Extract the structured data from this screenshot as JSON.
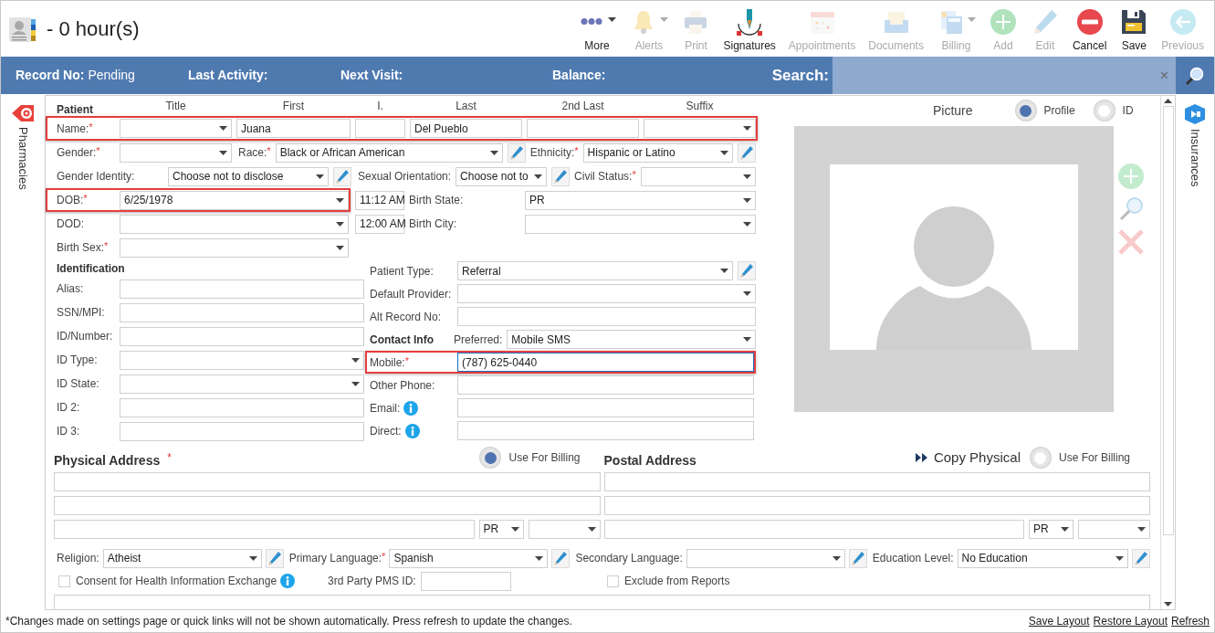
{
  "header": {
    "title": "- 0 hour(s)"
  },
  "toolbar": [
    {
      "label": "More",
      "kind": "more",
      "disabled": false,
      "dropdown": true
    },
    {
      "label": "Alerts",
      "kind": "bell",
      "disabled": true,
      "dropdown": true
    },
    {
      "label": "Print",
      "kind": "printer",
      "disabled": true,
      "dropdown": false
    },
    {
      "label": "Signatures",
      "kind": "pen",
      "disabled": false,
      "dropdown": false
    },
    {
      "label": "Appointments",
      "kind": "calendar",
      "disabled": true,
      "dropdown": false
    },
    {
      "label": "Documents",
      "kind": "tray",
      "disabled": true,
      "dropdown": false
    },
    {
      "label": "Billing",
      "kind": "calculator",
      "disabled": true,
      "dropdown": true
    },
    {
      "label": "Add",
      "kind": "add",
      "disabled": true,
      "dropdown": false
    },
    {
      "label": "Edit",
      "kind": "pencil",
      "disabled": true,
      "dropdown": false
    },
    {
      "label": "Cancel",
      "kind": "cancel",
      "disabled": false,
      "dropdown": false
    },
    {
      "label": "Save",
      "kind": "save",
      "disabled": false,
      "dropdown": false
    },
    {
      "label": "Previous",
      "kind": "back",
      "disabled": true,
      "dropdown": false
    }
  ],
  "info_bar": {
    "items": [
      {
        "label": "Record No:",
        "value": "Pending"
      },
      {
        "label": "Last Activity:"
      },
      {
        "label": "Next Visit:"
      },
      {
        "label": "Balance:"
      }
    ],
    "search_label": "Search:",
    "search_clear": "×"
  },
  "left_tab": "Pharmacies",
  "right_tab": "Insurances",
  "patient": {
    "heading": "Patient",
    "columns": [
      "Title",
      "First",
      "I.",
      "Last",
      "2nd Last",
      "Suffix"
    ],
    "name": {
      "label": "Name:",
      "required_mark": "*",
      "highlighted": true,
      "fields": [
        {
          "kind": "dropdown"
        },
        {
          "kind": "text",
          "value": "Juana"
        },
        {
          "kind": "text"
        },
        {
          "kind": "text",
          "value": "Del Pueblo"
        },
        {
          "kind": "text"
        },
        {
          "kind": "dropdown"
        }
      ]
    },
    "rows": [
      {
        "highlighted": false,
        "items": [
          {
            "label": "Gender:",
            "required_mark": "*",
            "kind": "dropdown"
          },
          {
            "label": "Race:",
            "required_mark": "*",
            "kind": "dropdown",
            "value": "Black or African American"
          },
          {
            "label": "Ethnicity:",
            "required_mark": "*",
            "kind": "dropdown",
            "value": "Hispanic or Latino"
          }
        ]
      },
      {
        "highlighted": false,
        "items": [
          {
            "label": "Gender Identity:",
            "kind": "dropdown",
            "value": "Choose not to disclose"
          },
          {
            "label": "Sexual Orientation:",
            "kind": "dropdown",
            "value": "Choose not to"
          },
          {
            "label": "Civil Status:",
            "required_mark": "*",
            "kind": "dropdown"
          }
        ]
      },
      {
        "highlighted": true,
        "items": [
          {
            "label": "DOB:",
            "required_mark": "*",
            "kind": "dropdown",
            "value": "6/25/1978"
          },
          {
            "kind": "time",
            "value": "11:12 AM"
          },
          {
            "label": "Birth State:",
            "kind": "dropdown",
            "value": "PR"
          }
        ]
      },
      {
        "highlighted": false,
        "items": [
          {
            "label": "DOD:",
            "kind": "dropdown"
          },
          {
            "kind": "time",
            "value": "12:00 AM"
          },
          {
            "label": "Birth City:",
            "kind": "dropdown"
          }
        ]
      },
      {
        "highlighted": false,
        "items": [
          {
            "label": "Birth Sex:",
            "required_mark": "*",
            "kind": "dropdown"
          }
        ]
      }
    ]
  },
  "identification": {
    "heading": "Identification",
    "rows": [
      {
        "label": "Alias:",
        "kind": "text"
      },
      {
        "label": "SSN/MPI:",
        "kind": "text"
      },
      {
        "label": "ID/Number:",
        "kind": "text"
      },
      {
        "label": "ID Type:",
        "kind": "dropdown"
      },
      {
        "label": "ID State:",
        "kind": "dropdown"
      },
      {
        "label": "ID 2:",
        "kind": "text"
      },
      {
        "label": "ID 3:",
        "kind": "text"
      }
    ]
  },
  "details": [
    {
      "label": "Patient Type:",
      "kind": "dropdown",
      "value": "Referral"
    },
    {
      "label": "Default Provider:",
      "kind": "dropdown"
    },
    {
      "label": "Alt Record No:",
      "kind": "text"
    }
  ],
  "contact": {
    "heading": "Contact Info",
    "preferred": {
      "label": "Preferred:",
      "kind": "dropdown",
      "value": "Mobile SMS"
    },
    "rows": [
      {
        "label": "Mobile:",
        "required_mark": "*",
        "kind": "text",
        "value": "(787) 625-0440",
        "focused": true,
        "highlighted": true,
        "info": false
      },
      {
        "label": "Other Phone:",
        "kind": "text",
        "focused": false,
        "highlighted": false,
        "info": false
      },
      {
        "label": "Email:",
        "kind": "text",
        "focused": false,
        "highlighted": false,
        "info": true
      },
      {
        "label": "Direct:",
        "kind": "text",
        "focused": false,
        "highlighted": false,
        "info": true
      }
    ]
  },
  "picture": {
    "title": "Picture",
    "options": [
      {
        "label": "Profile",
        "selected": true
      },
      {
        "label": "ID",
        "selected": false
      }
    ]
  },
  "physical_address": {
    "title": "Physical Address",
    "required_mark": "*",
    "billing": {
      "label": "Use For Billing",
      "selected": true
    },
    "state": "PR"
  },
  "postal_address": {
    "title": "Postal Address",
    "copy": "Copy Physical",
    "billing": {
      "label": "Use For Billing",
      "selected": false
    },
    "state": "PR"
  },
  "extras": [
    {
      "label": "Religion:",
      "value": "Atheist"
    },
    {
      "label": "Primary Language:",
      "required_mark": "*",
      "value": "Spanish"
    },
    {
      "label": "Secondary Language:"
    },
    {
      "label": "Education Level:",
      "value": "No Education"
    }
  ],
  "consent": {
    "label": "Consent for Health Information Exchange",
    "checked": false
  },
  "pms_id": {
    "label": "3rd Party PMS ID:"
  },
  "exclude": {
    "label": "Exclude from Reports",
    "checked": false
  },
  "footer": {
    "note": "*Changes made on settings page or quick links will not be shown automatically. Press refresh to update the changes.",
    "links": [
      "Save Layout",
      "Restore Layout",
      "Refresh"
    ]
  }
}
